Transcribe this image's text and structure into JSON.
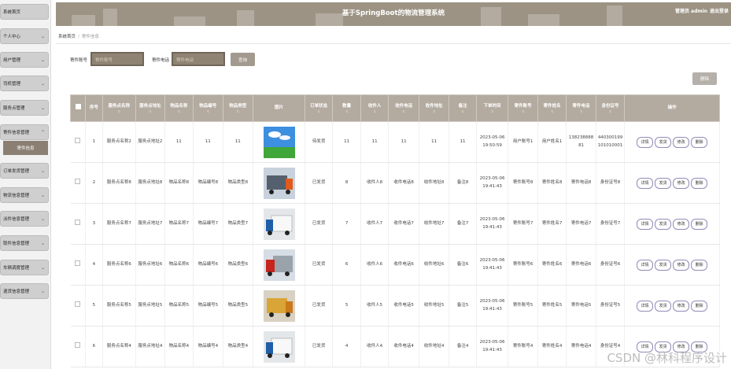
{
  "app": {
    "title": "基于SpringBoot的物流管理系统",
    "user_label": "管理员 admin",
    "logout": "退出登录"
  },
  "sidebar": [
    {
      "label": "系统首页"
    },
    {
      "label": "个人中心"
    },
    {
      "label": "用户管理"
    },
    {
      "label": "司机管理"
    },
    {
      "label": "服务点管理"
    },
    {
      "label": "寄件信息管理",
      "sub": "寄件信息"
    },
    {
      "label": "订单发货管理"
    },
    {
      "label": "物流信息管理"
    },
    {
      "label": "派件信息管理"
    },
    {
      "label": "取件信息管理"
    },
    {
      "label": "车辆调度管理"
    },
    {
      "label": "退货信息管理"
    }
  ],
  "breadcrumb": {
    "home": "系统首页",
    "current": "寄件信息"
  },
  "search": {
    "label1": "寄件账号",
    "placeholder1": "寄件账号",
    "label2": "寄件电话",
    "placeholder2": "寄件电话",
    "button": "查询",
    "delete": "删除"
  },
  "table": {
    "headers": [
      "序号",
      "服务点名称",
      "服务点地址",
      "物品名称",
      "物品编号",
      "物品类型",
      "图片",
      "订单状态",
      "数量",
      "收件人",
      "收件电话",
      "收件地址",
      "备注",
      "下单时间",
      "寄件账号",
      "寄件姓名",
      "寄件电话",
      "身份证号",
      "操作"
    ],
    "ops": [
      "详情",
      "发货",
      "修改",
      "删除"
    ],
    "rows": [
      {
        "no": "1",
        "site_name": "服务点名称2",
        "site_addr": "服务点地址2",
        "item_name": "11",
        "item_no": "11",
        "item_type": "11",
        "img": "grass",
        "status": "待发货",
        "qty": "11",
        "receiver": "11",
        "recv_phone": "11",
        "recv_addr": "11",
        "remark": "11",
        "time": "2023-05-06 19:50:59",
        "acct": "用户账号1",
        "name": "用户姓名1",
        "phone": "13823888881",
        "idno": "440300199101010001"
      },
      {
        "no": "2",
        "site_name": "服务点名称8",
        "site_addr": "服务点地址8",
        "item_name": "物品名称8",
        "item_no": "物品编号8",
        "item_type": "物品类型8",
        "img": "truck-blue",
        "status": "已发货",
        "qty": "8",
        "receiver": "收件人8",
        "recv_phone": "收件电话8",
        "recv_addr": "收件地址8",
        "remark": "备注8",
        "time": "2023-05-06 19:41:43",
        "acct": "寄件账号8",
        "name": "寄件姓名8",
        "phone": "寄件电话8",
        "idno": "身份证号8"
      },
      {
        "no": "3",
        "site_name": "服务点名称7",
        "site_addr": "服务点地址7",
        "item_name": "物品名称7",
        "item_no": "物品编号7",
        "item_type": "物品类型7",
        "img": "truck-white",
        "status": "已发货",
        "qty": "7",
        "receiver": "收件人7",
        "recv_phone": "收件电话7",
        "recv_addr": "收件地址7",
        "remark": "备注7",
        "time": "2023-05-06 19:41:43",
        "acct": "寄件账号7",
        "name": "寄件姓名7",
        "phone": "寄件电话7",
        "idno": "身份证号7"
      },
      {
        "no": "4",
        "site_name": "服务点名称6",
        "site_addr": "服务点地址6",
        "item_name": "物品名称6",
        "item_no": "物品编号6",
        "item_type": "物品类型6",
        "img": "truck-red",
        "status": "已发货",
        "qty": "6",
        "receiver": "收件人6",
        "recv_phone": "收件电话6",
        "recv_addr": "收件地址6",
        "remark": "备注6",
        "time": "2023-05-06 19:41:43",
        "acct": "寄件账号6",
        "name": "寄件姓名6",
        "phone": "寄件电话6",
        "idno": "身份证号6"
      },
      {
        "no": "5",
        "site_name": "服务点名称5",
        "site_addr": "服务点地址5",
        "item_name": "物品名称5",
        "item_no": "物品编号5",
        "item_type": "物品类型5",
        "img": "truck-yellow",
        "status": "已发货",
        "qty": "5",
        "receiver": "收件人5",
        "recv_phone": "收件电话5",
        "recv_addr": "收件地址5",
        "remark": "备注5",
        "time": "2023-05-06 19:41:43",
        "acct": "寄件账号5",
        "name": "寄件姓名5",
        "phone": "寄件电话5",
        "idno": "身份证号5"
      },
      {
        "no": "6",
        "site_name": "服务点名称4",
        "site_addr": "服务点地址4",
        "item_name": "物品名称4",
        "item_no": "物品编号4",
        "item_type": "物品类型4",
        "img": "truck-white",
        "status": "已发货",
        "qty": "4",
        "receiver": "收件人4",
        "recv_phone": "收件电话4",
        "recv_addr": "收件地址4",
        "remark": "备注4",
        "time": "2023-05-06 19:41:43",
        "acct": "寄件账号4",
        "name": "寄件姓名4",
        "phone": "寄件电话4",
        "idno": "身份证号4"
      }
    ]
  },
  "watermark": "CSDN @林科程序设计",
  "colors": {
    "header": "#9c9384",
    "table_header": "#b3aba0",
    "sidebar_active": "#8a7f72",
    "op_border": "#8f8cb8"
  }
}
